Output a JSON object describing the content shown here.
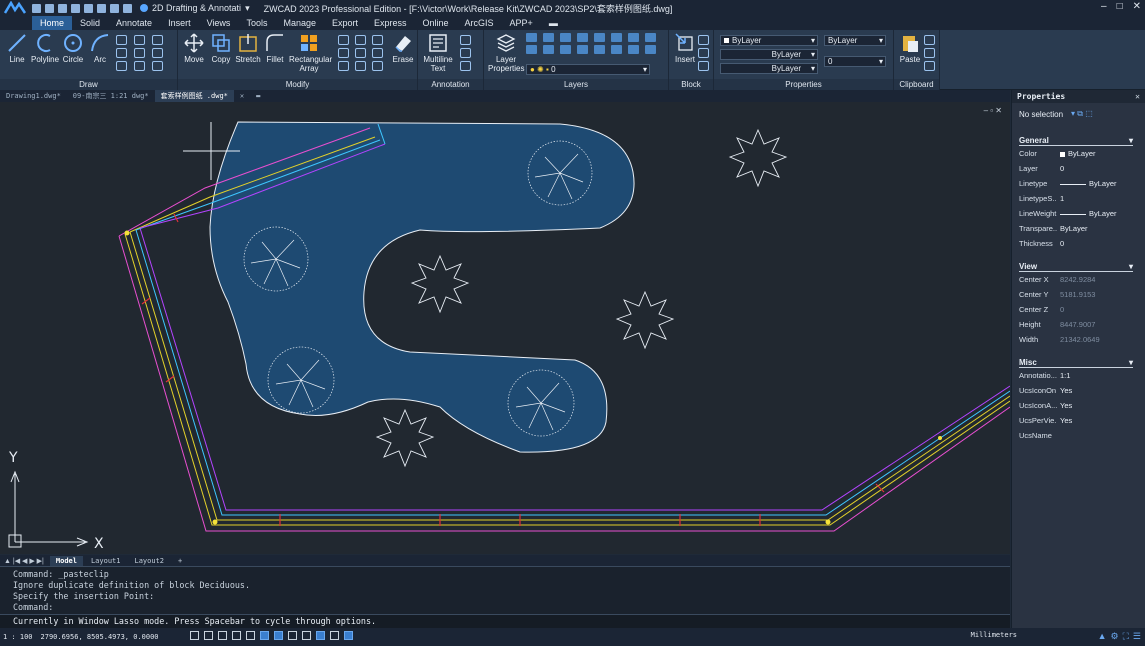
{
  "titlebar": {
    "workspace": "2D Drafting & Annotati",
    "title": "ZWCAD 2023 Professional Edition - [F:\\Victor\\Work\\Release Kit\\ZWCAD 2023\\SP2\\套索样例图纸.dwg]"
  },
  "ribbon_tabs": [
    "Home",
    "Solid",
    "Annotate",
    "Insert",
    "Views",
    "Tools",
    "Manage",
    "Export",
    "Express",
    "Online",
    "ArcGIS",
    "APP+"
  ],
  "ribbon": {
    "draw": {
      "label": "Draw",
      "line": "Line",
      "polyline": "Polyline",
      "circle": "Circle",
      "arc": "Arc"
    },
    "modify": {
      "label": "Modify",
      "move": "Move",
      "copy": "Copy",
      "stretch": "Stretch",
      "fillet": "Fillet",
      "array": "Rectangular Array",
      "erase": "Erase"
    },
    "annotation": {
      "label": "Annotation",
      "mtext": "Multiline Text"
    },
    "layers": {
      "label": "Layers",
      "props": "Layer Properties",
      "current": "0"
    },
    "block": {
      "label": "Block",
      "insert": "Insert"
    },
    "properties": {
      "label": "Properties",
      "color": "ByLayer",
      "linetype": "ByLayer",
      "lineweight": "ByLayer",
      "plotstyle": "ByLayer",
      "transparency": "0"
    },
    "clipboard": {
      "label": "Clipboard",
      "paste": "Paste"
    }
  },
  "doc_tabs": [
    "Drawing1.dwg*",
    "09-南宗三  1:21 dwg*",
    "套索样例图纸 .dwg*"
  ],
  "layout_tabs": [
    "Model",
    "Layout1",
    "Layout2",
    "+"
  ],
  "command": {
    "history": [
      "Command: _pasteclip",
      "Ignore duplicate definition of block Deciduous.",
      "Specify the insertion Point:",
      "Command:"
    ],
    "prompt": "Currently in Window Lasso mode. Press Spacebar to cycle through options."
  },
  "status": {
    "scale": "1 : 100",
    "coords": "2790.6956, 8505.4973, 0.0000",
    "units": "Millimeters"
  },
  "properties": {
    "title": "Properties",
    "selection": "No selection",
    "general_title": "General",
    "general": [
      {
        "k": "Color",
        "v": "ByLayer"
      },
      {
        "k": "Layer",
        "v": "0"
      },
      {
        "k": "Linetype",
        "v": "ByLayer"
      },
      {
        "k": "LinetypeS...",
        "v": "1"
      },
      {
        "k": "LineWeight",
        "v": "ByLayer"
      },
      {
        "k": "Transpare...",
        "v": "ByLayer"
      },
      {
        "k": "Thickness",
        "v": "0"
      }
    ],
    "view_title": "View",
    "view": [
      {
        "k": "Center X",
        "v": "8242.9284"
      },
      {
        "k": "Center Y",
        "v": "5181.9153"
      },
      {
        "k": "Center Z",
        "v": "0"
      },
      {
        "k": "Height",
        "v": "8447.9007"
      },
      {
        "k": "Width",
        "v": "21342.0649"
      }
    ],
    "misc_title": "Misc",
    "misc": [
      {
        "k": "Annotatio...",
        "v": "1:1"
      },
      {
        "k": "UcsIconOn",
        "v": "Yes"
      },
      {
        "k": "UcsIconA...",
        "v": "Yes"
      },
      {
        "k": "UcsPerVie...",
        "v": "Yes"
      },
      {
        "k": "UcsName",
        "v": ""
      }
    ]
  },
  "ucs": {
    "y": "Y",
    "x": "X"
  },
  "colors": {
    "accent": "#2b5f97",
    "pond": "#1e4a72",
    "canvas": "#212830"
  }
}
